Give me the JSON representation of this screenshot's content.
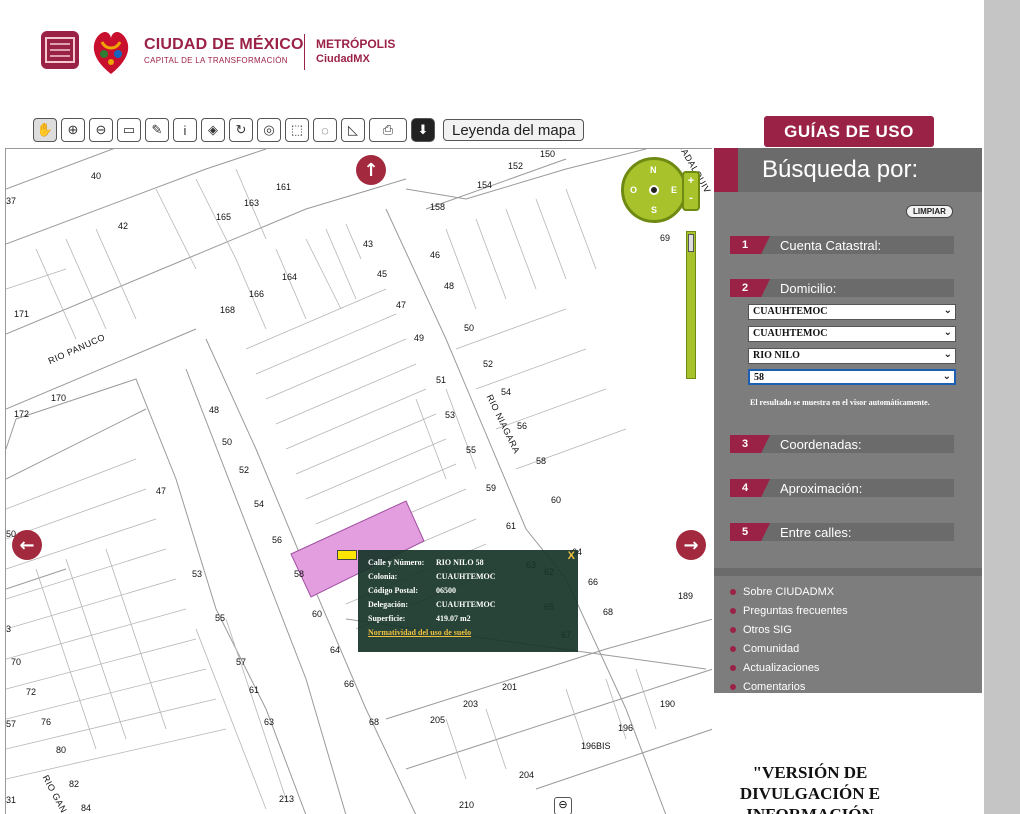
{
  "header": {
    "brand_title": "CIUDAD DE MÉXICO",
    "brand_subtitle": "CAPITAL DE LA TRANSFORMACIÓN",
    "metro_title": "METRÓPOLIS",
    "metro_subtitle": "CiudadMX"
  },
  "toolbar": {
    "tools": [
      {
        "name": "pan-hand-icon",
        "glyph": "✋"
      },
      {
        "name": "zoom-in-icon",
        "glyph": "⊕"
      },
      {
        "name": "zoom-out-icon",
        "glyph": "⊖"
      },
      {
        "name": "measure-ruler-icon",
        "glyph": "▭"
      },
      {
        "name": "pin-icon",
        "glyph": "✎"
      },
      {
        "name": "info-icon",
        "glyph": "i"
      },
      {
        "name": "eraser-icon",
        "glyph": "◈"
      },
      {
        "name": "refresh-icon",
        "glyph": "↻"
      },
      {
        "name": "locate-icon",
        "glyph": "◎"
      },
      {
        "name": "select-rectangle-icon",
        "glyph": "⬚"
      },
      {
        "name": "select-lasso-icon",
        "glyph": "◌"
      },
      {
        "name": "select-polygon-icon",
        "glyph": "◺"
      },
      {
        "name": "print-icon",
        "glyph": "⎙"
      },
      {
        "name": "download-icon",
        "glyph": "⬇"
      }
    ],
    "legend_label": "Leyenda del mapa",
    "guides_label": "GUÍAS DE USO"
  },
  "map": {
    "lot_numbers": [
      "40",
      "37",
      "42",
      "161",
      "165",
      "163",
      "152",
      "154",
      "158",
      "150",
      "69",
      "43",
      "45",
      "46",
      "48",
      "164",
      "166",
      "168",
      "47",
      "50",
      "49",
      "171",
      "52",
      "51",
      "54",
      "53",
      "56",
      "55",
      "58",
      "170",
      "172",
      "48",
      "50",
      "52",
      "47",
      "54",
      "56",
      "59",
      "60",
      "61",
      "64",
      "58",
      "189",
      "66",
      "68",
      "53",
      "55",
      "57",
      "60",
      "64",
      "62",
      "63",
      "65",
      "67",
      "201",
      "203",
      "205",
      "190",
      "196",
      "196BIS",
      "204",
      "210",
      "213",
      "84",
      "82",
      "31",
      "70",
      "72",
      "76",
      "80",
      "61",
      "63",
      "66",
      "68",
      "50",
      "57",
      "3"
    ],
    "street_names": [
      "RIO PANUCO",
      "RIO NIAGARA",
      "RIO GAN",
      "UADALQUIV"
    ],
    "compass": {
      "n": "N",
      "s": "S",
      "e": "E",
      "o": "O"
    },
    "zoom_plus": "+",
    "zoom_minus": "-"
  },
  "popup": {
    "close": "X",
    "fields": [
      {
        "k": "Calle y Número:",
        "v": "RIO NILO 58"
      },
      {
        "k": "Colonia:",
        "v": "CUAUHTEMOC"
      },
      {
        "k": "Código Postal:",
        "v": "06500"
      },
      {
        "k": "Delegación:",
        "v": "CUAUHTEMOC"
      },
      {
        "k": "Superficie:",
        "v": "419.07 m2"
      }
    ],
    "link": "Normatividad del uso de suelo"
  },
  "panel": {
    "title": "Búsqueda por:",
    "clear": "LIMPIAR",
    "sections": [
      {
        "num": "1",
        "label": "Cuenta Catastral:"
      },
      {
        "num": "2",
        "label": "Domicilio:"
      },
      {
        "num": "3",
        "label": "Coordenadas:"
      },
      {
        "num": "4",
        "label": "Aproximación:"
      },
      {
        "num": "5",
        "label": "Entre calles:"
      }
    ],
    "selects": [
      "CUAUHTEMOC",
      "CUAUHTEMOC",
      "RIO NILO",
      "58"
    ],
    "note": "El resultado se muestra en el visor automáticamente.",
    "links": [
      "Sobre CIUDADMX",
      "Preguntas frecuentes",
      "Otros SIG",
      "Comunidad",
      "Actualizaciones",
      "Comentarios"
    ],
    "version_text": "\"VERSIÓN DE DIVULGACIÓN E INFORMACIÓN"
  }
}
